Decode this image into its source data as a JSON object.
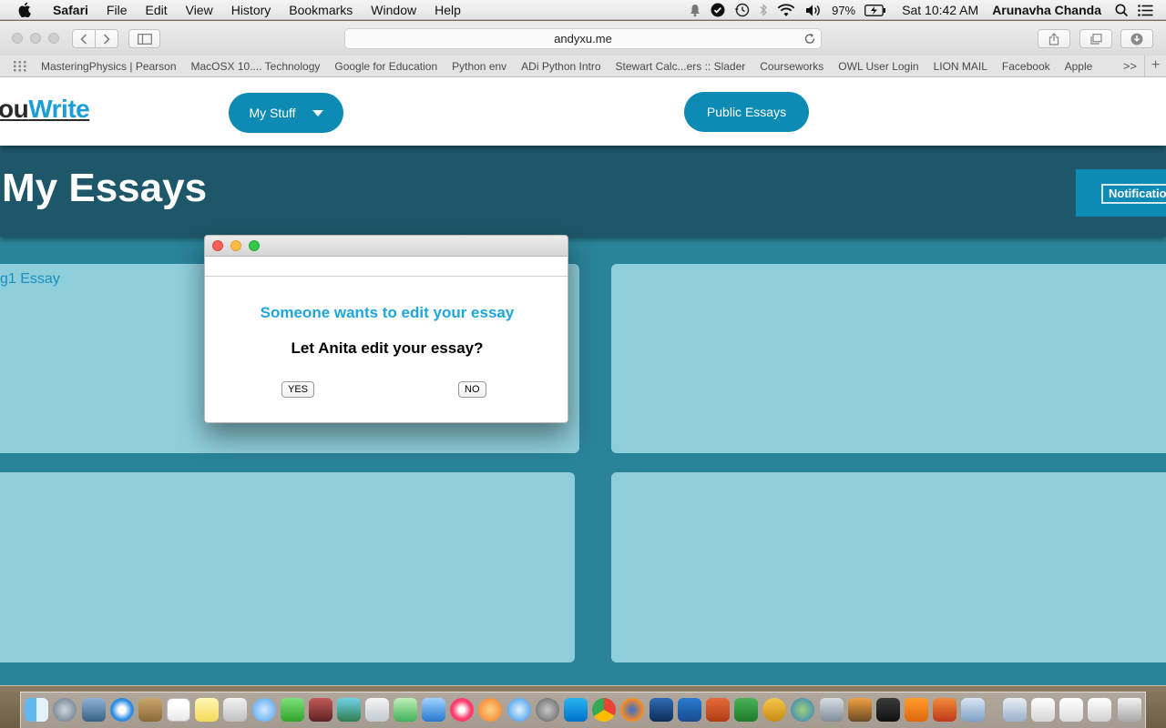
{
  "menubar": {
    "app_name": "Safari",
    "menus": [
      "File",
      "Edit",
      "View",
      "History",
      "Bookmarks",
      "Window",
      "Help"
    ],
    "battery": "97%",
    "clock": "Sat 10:42 AM",
    "user": "Arunavha Chanda"
  },
  "browser": {
    "url": "andyxu.me",
    "bookmarks": [
      "MasteringPhysics | Pearson",
      "MacOSX 10.... Technology",
      "Google for Education",
      "Python env",
      "ADi Python Intro",
      "Stewart Calc...ers :: Slader",
      "Courseworks",
      "OWL User Login",
      "LION MAIL",
      "Facebook",
      "Apple"
    ],
    "more": ">>",
    "add": "+"
  },
  "site": {
    "logo_prefix": "ou",
    "logo_suffix": "Write",
    "my_stuff": "My Stuff",
    "public_essays": "Public Essays",
    "page_title": "My Essays",
    "notifications": "Notifications",
    "card_label": "g1 Essay"
  },
  "dialog": {
    "heading": "Someone wants to edit your essay",
    "question": "Let Anita edit your essay?",
    "yes": "YES",
    "no": "NO"
  },
  "colors": {
    "accent": "#0d8bb5",
    "page_bg": "#2a8499",
    "band": "#1d5769",
    "card": "#8ecedb",
    "dialog_heading": "#1ea6dc"
  }
}
